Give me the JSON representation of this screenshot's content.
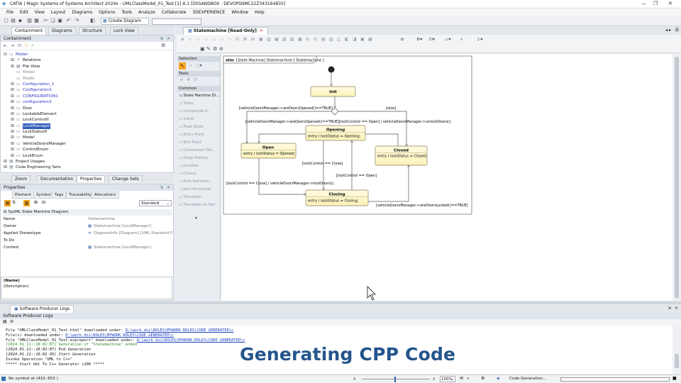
{
  "app": {
    "title": "CATIA | Magic Systems of Systems Architect 2024x - UMLClassModel_01_Test [1] A.1 [DSSANDBOX - DEVOPSNMC22Z343164835]",
    "minimize": "—",
    "restore": "❐",
    "close": "✕"
  },
  "menu": [
    "File",
    "Edit",
    "View",
    "Layout",
    "Diagrams",
    "Options",
    "Tools",
    "Analyze",
    "Collaborate",
    "3DEXPERIENCE",
    "Window",
    "Help"
  ],
  "toolbar": {
    "create_diagram": "Create Diagram"
  },
  "left_tabs": [
    "Containment",
    "Diagrams",
    "Structure",
    "Lock View"
  ],
  "containment": {
    "header": "Containment",
    "tree": [
      {
        "label": "Model",
        "depth": 0,
        "exp": "⊟",
        "icon": "▭",
        "style": "blue"
      },
      {
        "label": "Relations",
        "depth": 1,
        "exp": "⊞",
        "icon": "↗",
        "style": ""
      },
      {
        "label": "File View",
        "depth": 1,
        "exp": "⊞",
        "icon": "▤",
        "style": ""
      },
      {
        "label": "Model",
        "depth": 1,
        "exp": "",
        "icon": "▭",
        "style": "grey"
      },
      {
        "label": "Model",
        "depth": 1,
        "exp": "",
        "icon": "▭",
        "style": "grey"
      },
      {
        "label": "Configuration_1",
        "depth": 1,
        "exp": "⊞",
        "icon": "▭",
        "style": "blue"
      },
      {
        "label": "Configuration1",
        "depth": 1,
        "exp": "⊞",
        "icon": "▭",
        "style": "blue"
      },
      {
        "label": "CONFIGURATION1",
        "depth": 1,
        "exp": "⊞",
        "icon": "▭",
        "style": "blue"
      },
      {
        "label": "configuration3",
        "depth": 1,
        "exp": "⊞",
        "icon": "▭",
        "style": "blue"
      },
      {
        "label": "Door",
        "depth": 1,
        "exp": "⊞",
        "icon": "▭",
        "style": ""
      },
      {
        "label": "LockableElement",
        "depth": 1,
        "exp": "⊞",
        "icon": "▭",
        "style": ""
      },
      {
        "label": "LockControlIf",
        "depth": 1,
        "exp": "⊞",
        "icon": "▭",
        "style": ""
      },
      {
        "label": "LockManager",
        "depth": 1,
        "exp": "⊞",
        "icon": "▭",
        "style": "sel"
      },
      {
        "label": "LockStatusIf",
        "depth": 1,
        "exp": "⊞",
        "icon": "▭",
        "style": ""
      },
      {
        "label": "Model",
        "depth": 1,
        "exp": "⊞",
        "icon": "▭",
        "style": ""
      },
      {
        "label": "VehicleDoorsManager",
        "depth": 1,
        "exp": "⊞",
        "icon": "▭",
        "style": ""
      },
      {
        "label": "ControlEnum",
        "depth": 1,
        "exp": "⊞",
        "icon": "▭",
        "style": ""
      },
      {
        "label": "LockEnum",
        "depth": 1,
        "exp": "⊞",
        "icon": "▭",
        "style": ""
      },
      {
        "label": "Project Usages",
        "depth": 0,
        "exp": "⊞",
        "icon": "▤",
        "style": ""
      },
      {
        "label": "Code Engineering Sets",
        "depth": 0,
        "exp": "⊞",
        "icon": "▤",
        "style": ""
      }
    ]
  },
  "mid_tabs": [
    "Zoom",
    "Documentation",
    "Properties",
    "Change Sets"
  ],
  "properties": {
    "header": "Properties",
    "tabs": [
      "Element",
      "Symbol",
      "Tags",
      "Traceability",
      "Allocations"
    ],
    "mode": "Standard",
    "section": "SysML State Machine Diagram",
    "rows": [
      {
        "k": "Name",
        "v": "Statemachine"
      },
      {
        "k": "Owner",
        "v": "Statemachine [LockManager]"
      },
      {
        "k": "Applied Stereotype",
        "v": "DiagramInfo [Diagram] [UML Standard P"
      },
      {
        "k": "To Do",
        "v": ""
      },
      {
        "k": "Context",
        "v": "Statemachine [LockManager]"
      }
    ],
    "desc_name": "(Name)",
    "desc_text": "(Description)"
  },
  "editor_tab": "Statemachine [Read-Only]",
  "palette": {
    "selection": "Selection",
    "tools": "Tools",
    "common": "Common",
    "items": [
      {
        "label": "State Machine Di...",
        "dis": false
      },
      {
        "label": "State",
        "dis": true
      },
      {
        "label": "Composite S...",
        "dis": true
      },
      {
        "label": "Initial",
        "dis": true
      },
      {
        "label": "Final State",
        "dis": true
      },
      {
        "label": "Entry Point",
        "dis": true
      },
      {
        "label": "Exit Point",
        "dis": true
      },
      {
        "label": "Connection Poi...",
        "dis": true
      },
      {
        "label": "Deep History",
        "dis": true
      },
      {
        "label": "Junction",
        "dis": true
      },
      {
        "label": "Choice",
        "dis": true
      },
      {
        "label": "Fork Horizont...",
        "dis": true
      },
      {
        "label": "Join Horizontal",
        "dis": true
      },
      {
        "label": "Transition",
        "dis": true
      },
      {
        "label": "Transition to Self",
        "dis": true
      }
    ]
  },
  "diagram": {
    "frame_label_kw": "stm",
    "frame_label": "[State Machine] Statemachine [ Statemachine ]",
    "states": {
      "init": "Init",
      "opening": "Opening",
      "opening_entry": "entry / lockStatus = Opening;",
      "open": "Open",
      "open_entry": "entry / lockStatus = Opened;",
      "closed": "Closed",
      "closed_entry": "entry / lockStatus = Closed;",
      "closing": "Closing",
      "closing_entry": "entry / lockStatus = Closing;"
    },
    "transitions": {
      "t1": "[vehicleDoorsManager->areDoorsOpened()==TRUE]",
      "t2": "[else]",
      "t3": "[vehicleDoorsManager->areDoorsOpened()==TRUE]",
      "t4": "[lockControl == Open] / vehicleDoorsManager->unlockDoors();",
      "t5": "[lockControl == Close]",
      "t6": "[lockControl == Open]",
      "t7": "[lockControl == Close] / vehicleDoorsManager->lockDoors();",
      "t8": "[vehicleDoorsManager->areDoorsLocked()==TRUE]"
    }
  },
  "bottom": {
    "tab": "Software Producer Logs",
    "header": "Software Producer Logs",
    "lines": [
      {
        "text": "File \"UMLClassModel_01_Test.html\" downloaded under: ",
        "link": "D:\\work_dsi\\ROLES\\MYWORK-ROLES\\CODE_GENERATED\\c",
        "cls": ""
      },
      {
        "text": "File(s) downloaded under: ",
        "link": "D:\\work_dsi\\ROLES\\MYWORK-ROLES\\CODE_GENERATED\\c",
        "cls": ""
      },
      {
        "text": "File \"UMLClassModel_01_Test.espreport\" downloaded under: ",
        "link": "D:\\work_dsi\\ROLES\\MYWORK-ROLES\\CODE_GENERATED\\c",
        "cls": ""
      },
      {
        "text": "[2024.01.11::18:02:07] Generation of \"Statemachine\" ended",
        "link": "",
        "cls": "grn"
      },
      {
        "text": "[2024.01.11::18:02:07] End Generation",
        "link": "",
        "cls": "it"
      },
      {
        "text": "[2024.01.11::18:02:38] Start Generation",
        "link": "",
        "cls": "it"
      },
      {
        "text": "Invoke Operation \"UML to C++\"",
        "link": "",
        "cls": ""
      },
      {
        "text": "***** Start Uml To C++ Generator v100 *****",
        "link": "",
        "cls": ""
      }
    ],
    "overlay": "Generating CPP Code"
  },
  "status": {
    "left": "No symbol at (410, 653 )",
    "zoom": "100%",
    "progress_label": "Code Generation..."
  }
}
